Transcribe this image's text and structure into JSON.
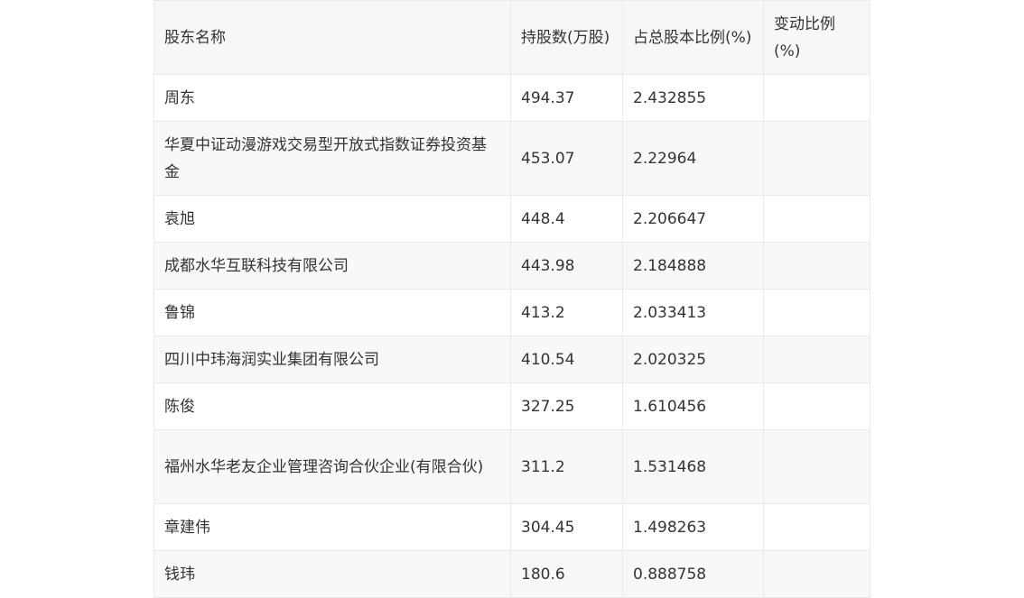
{
  "table": {
    "headers": [
      "股东名称",
      "持股数(万股)",
      "占总股本比例(%)",
      "变动比例(%)"
    ],
    "rows": [
      [
        "周东",
        "494.37",
        "2.432855",
        ""
      ],
      [
        "华夏中证动漫游戏交易型开放式指数证券投资基金",
        "453.07",
        "2.22964",
        ""
      ],
      [
        "袁旭",
        "448.4",
        "2.206647",
        ""
      ],
      [
        "成都水华互联科技有限公司",
        "443.98",
        "2.184888",
        ""
      ],
      [
        "鲁锦",
        "413.2",
        "2.033413",
        ""
      ],
      [
        "四川中玮海润实业集团有限公司",
        "410.54",
        "2.020325",
        ""
      ],
      [
        "陈俊",
        "327.25",
        "1.610456",
        ""
      ],
      [
        "福州水华老友企业管理咨询合伙企业(有限合伙)",
        "311.2",
        "1.531468",
        ""
      ],
      [
        "章建伟",
        "304.45",
        "1.498263",
        ""
      ],
      [
        "钱玮",
        "180.6",
        "0.888758",
        ""
      ]
    ]
  }
}
